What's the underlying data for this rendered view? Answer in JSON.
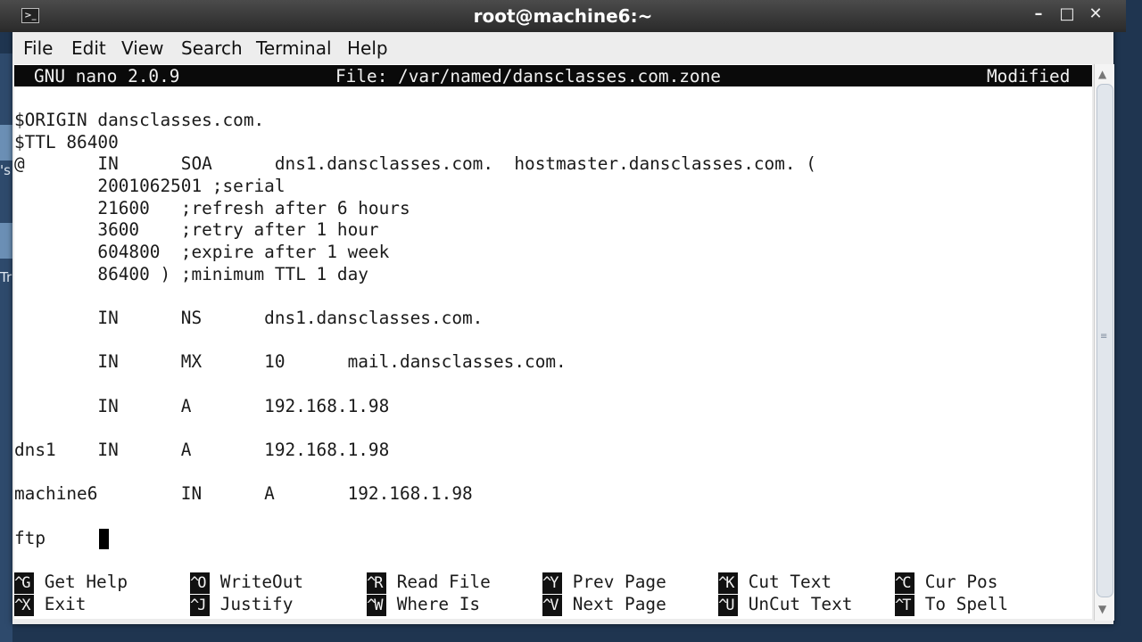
{
  "window": {
    "title": "root@machine6:~",
    "controls": [
      "–",
      "□",
      "✕"
    ]
  },
  "desktop": {
    "fragments": [
      "'s",
      "Tr"
    ]
  },
  "menu": [
    "File",
    "Edit",
    "View",
    "Search",
    "Terminal",
    "Help"
  ],
  "nano": {
    "version": "GNU nano 2.0.9",
    "file": "File: /var/named/dansclasses.com.zone",
    "status": "Modified"
  },
  "lines": [
    "$ORIGIN dansclasses.com.",
    "$TTL 86400",
    "@       IN      SOA      dns1.dansclasses.com.  hostmaster.dansclasses.com. (",
    "        2001062501 ;serial",
    "        21600   ;refresh after 6 hours",
    "        3600    ;retry after 1 hour",
    "        604800  ;expire after 1 week",
    "        86400 ) ;minimum TTL 1 day",
    "",
    "        IN      NS      dns1.dansclasses.com.",
    "",
    "        IN      MX      10      mail.dansclasses.com.",
    "",
    "        IN      A       192.168.1.98",
    "",
    "dns1    IN      A       192.168.1.98",
    "",
    "machine6        IN      A       192.168.1.98",
    "",
    "ftp     "
  ],
  "shortcuts": [
    {
      "key": "^G",
      "label": "Get Help"
    },
    {
      "key": "^O",
      "label": "WriteOut"
    },
    {
      "key": "^R",
      "label": "Read File"
    },
    {
      "key": "^Y",
      "label": "Prev Page"
    },
    {
      "key": "^K",
      "label": "Cut Text"
    },
    {
      "key": "^C",
      "label": "Cur Pos"
    },
    {
      "key": "^X",
      "label": "Exit"
    },
    {
      "key": "^J",
      "label": "Justify"
    },
    {
      "key": "^W",
      "label": "Where Is"
    },
    {
      "key": "^V",
      "label": "Next Page"
    },
    {
      "key": "^U",
      "label": "UnCut Text"
    },
    {
      "key": "^T",
      "label": "To Spell"
    }
  ]
}
